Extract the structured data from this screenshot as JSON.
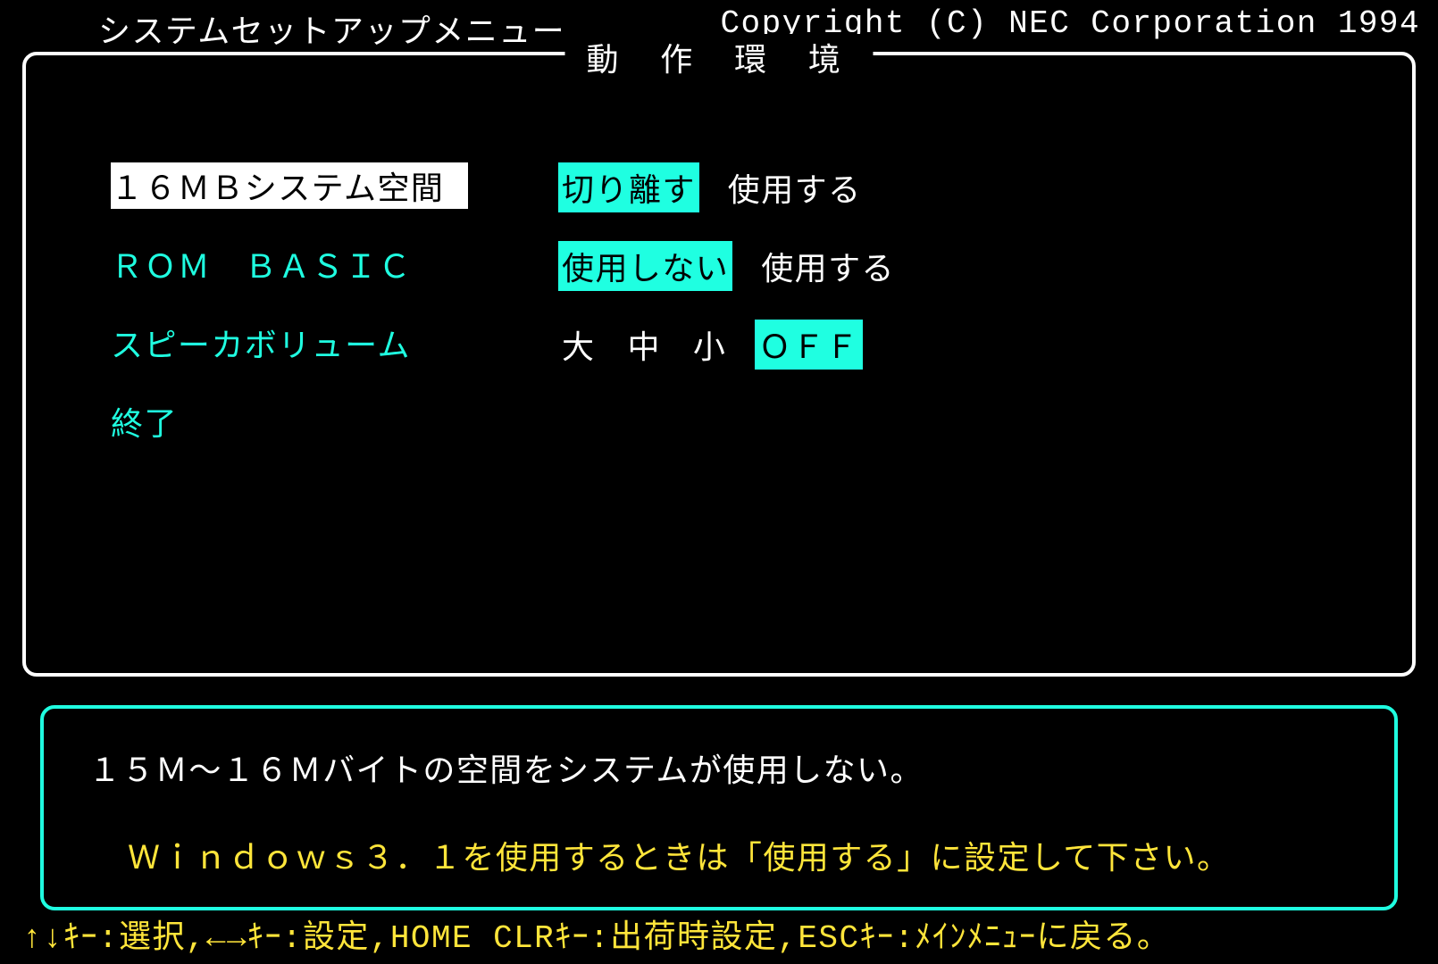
{
  "header": {
    "menu_title": "システムセットアップメニュー",
    "copyright": "Copyright (C) NEC Corporation 1994"
  },
  "panel": {
    "title": "動 作 環 境",
    "rows": {
      "r1": {
        "label": "１６ＭＢシステム空間",
        "opt_a": "切り離す",
        "opt_b": "使用する"
      },
      "r2": {
        "label": "ＲＯＭ　ＢＡＳＩＣ",
        "opt_a": "使用しない",
        "opt_b": "使用する"
      },
      "r3": {
        "label": "スピーカボリューム",
        "opt_a": "大",
        "opt_b": "中",
        "opt_c": "小",
        "opt_d": "ＯＦＦ"
      },
      "r4": {
        "label": "終了"
      }
    }
  },
  "help": {
    "line1": "１５Ｍ～１６Ｍバイトの空間をシステムが使用しない。",
    "line2": "Ｗｉｎｄｏｗｓ３．１を使用するときは「使用する」に設定して下さい。"
  },
  "legend": "↑↓ｷｰ:選択,←→ｷｰ:設定,HOME CLRｷｰ:出荷時設定,ESCｷｰ:ﾒｲﾝﾒﾆｭｰに戻る。"
}
